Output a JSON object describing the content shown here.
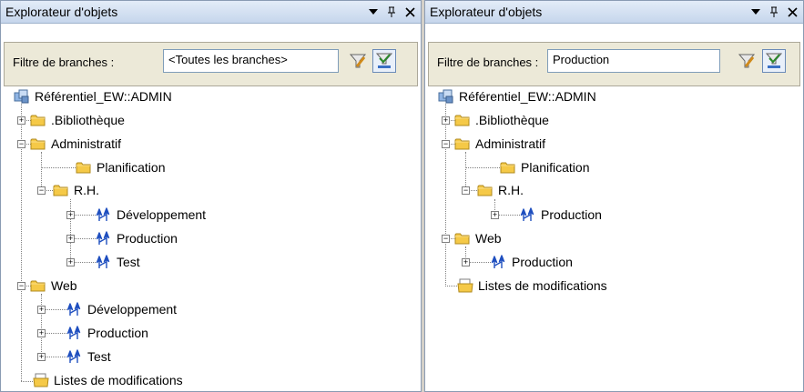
{
  "left": {
    "title": "Explorateur d'objets",
    "filter_label": "Filtre de branches :",
    "filter_value": "<Toutes les branches>",
    "tree": {
      "root": "Référentiel_EW::ADMIN",
      "bibliotheque": ".Bibliothèque",
      "administratif": "Administratif",
      "planification": "Planification",
      "rh": "R.H.",
      "rh_dev": "Développement",
      "rh_prod": "Production",
      "rh_test": "Test",
      "web": "Web",
      "web_dev": "Développement",
      "web_prod": "Production",
      "web_test": "Test",
      "changelists": "Listes de modifications"
    }
  },
  "right": {
    "title": "Explorateur d'objets",
    "filter_label": "Filtre de branches :",
    "filter_value": "Production",
    "tree": {
      "root": "Référentiel_EW::ADMIN",
      "bibliotheque": ".Bibliothèque",
      "administratif": "Administratif",
      "planification": "Planification",
      "rh": "R.H.",
      "rh_prod": "Production",
      "web": "Web",
      "web_prod": "Production",
      "changelists": "Listes de modifications"
    }
  },
  "icons": {
    "repository": "repository-icon",
    "folder": "folder-icon",
    "branch": "branch-icon",
    "changelist": "changelist-icon",
    "dropdown": "dropdown-arrow-icon",
    "pin": "pin-icon",
    "close": "close-icon",
    "filter": "branch-filter-icon",
    "filter_toggle": "branch-filter-toggle-icon"
  },
  "colors": {
    "titlebar": "#c6d6ec",
    "folder": "#f5c947",
    "branch": "#1f4fbf",
    "filterbar": "#ece9d8"
  }
}
